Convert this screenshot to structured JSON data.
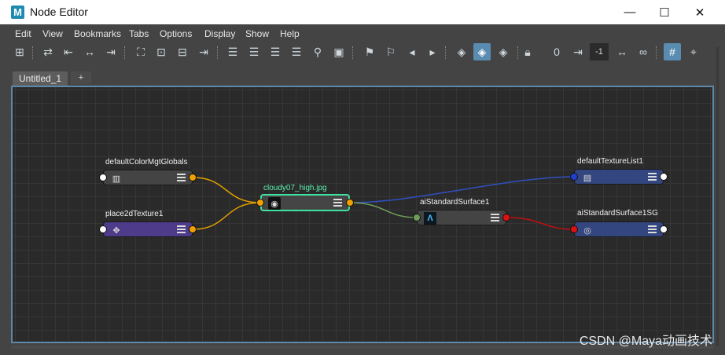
{
  "window": {
    "title": "Node Editor",
    "app_icon_letter": "M",
    "minimize_glyph": "—",
    "maximize_glyph": "☐",
    "close_glyph": "✕"
  },
  "menu": {
    "items": [
      "Edit",
      "View",
      "Bookmarks",
      "Tabs",
      "Options",
      "Display",
      "Show",
      "Help"
    ]
  },
  "toolbar": {
    "depth_field_value": "-1",
    "zero_label": "0"
  },
  "tabs": {
    "items": [
      "Untitled_1"
    ],
    "add_label": "+"
  },
  "graph": {
    "nodes": [
      {
        "name": "defaultColorMgtGlobals",
        "type": "dark"
      },
      {
        "name": "place2dTexture1",
        "type": "purple"
      },
      {
        "name": "cloudy07_high.jpg",
        "type": "selected"
      },
      {
        "name": "aiStandardSurface1",
        "type": "dark"
      },
      {
        "name": "defaultTextureList1",
        "type": "blue"
      },
      {
        "name": "aiStandardSurface1SG",
        "type": "blue"
      }
    ],
    "colors": {
      "node_dark": "#444444",
      "node_purple": "#4e3b8a",
      "node_blue": "#34467f",
      "selected_border": "#3fe0a0",
      "wire_yellow": "#e0a000",
      "wire_blue": "#3050c0",
      "wire_green": "#6e9d5b",
      "wire_red": "#c01010",
      "port_orange": "#f0a000",
      "port_white": "#ffffff",
      "port_green": "#6e9d5b",
      "port_red": "#e01010",
      "port_blue": "#2040d0"
    }
  },
  "watermark": "CSDN @Maya动画技术"
}
